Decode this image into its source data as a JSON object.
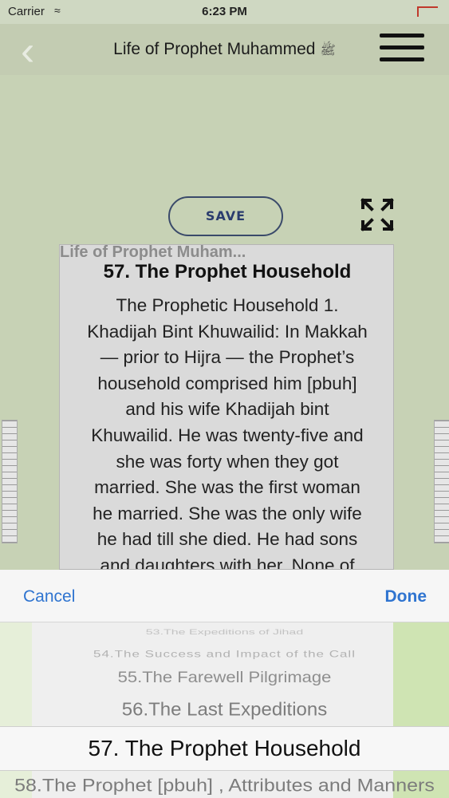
{
  "status_bar": {
    "carrier": "Carrier",
    "time": "6:23 PM"
  },
  "nav": {
    "title": "Life of Prophet Muhammed",
    "emblem": "ﷺ",
    "back_icon": "chevron-left-icon",
    "menu_icon": "hamburger-menu-icon"
  },
  "content": {
    "save_label": "SAVE",
    "expand_icon": "expand-arrows-icon",
    "page": {
      "app_name": "Life of Prophet Muham...",
      "chapter_title": "57. The Prophet Household",
      "lines": [
        "The Prophetic Household 1.",
        "Khadijah Bint Khuwailid: In Makkah",
        "— prior to Hijra — the Prophet’s",
        "household comprised him [pbuh]",
        "and his wife Khadijah bint",
        "Khuwailid. He was twenty-five and",
        "she was forty when they got",
        "married. She was the first woman",
        "he married. She was the only wife",
        "he had till she died. He had sons",
        "and daughters with her. None of"
      ]
    }
  },
  "picker": {
    "cancel_label": "Cancel",
    "done_label": "Done",
    "options": [
      "53.The Expeditions of Jihad",
      "54.The Success and Impact of the Call",
      "55.The Farewell Pilgrimage",
      "56.The Last Expeditions",
      "57. The Prophet Household",
      "58.The Prophet [pbuh] , Attributes and Manners"
    ],
    "selected": "57. The Prophet Household"
  },
  "colors": {
    "accent": "#2f74d0",
    "background": "#c7d2b5",
    "save_text": "#2a3c6e"
  }
}
